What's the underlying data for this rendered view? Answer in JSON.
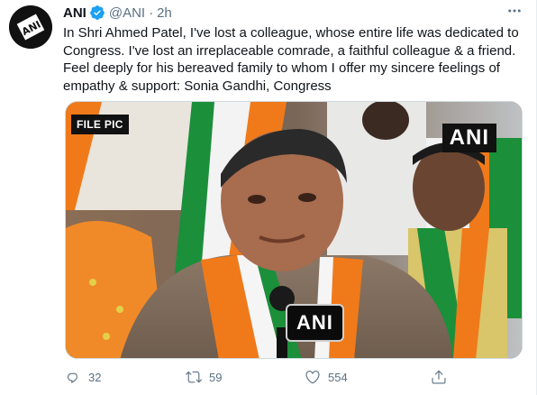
{
  "tweet": {
    "author_name": "ANI",
    "handle": "@ANI",
    "separator": "·",
    "time": "2h",
    "text": "In Shri Ahmed Patel, I've lost a colleague, whose entire life was dedicated to Congress. I've lost an irreplaceable comrade, a faithful colleague & a friend. Feel deeply for his bereaved family to whom I offer my sincere feelings of empathy & support: Sonia Gandhi, Congress",
    "verified": true,
    "accent_color": "#1da1f2"
  },
  "media": {
    "file_pic_label": "FILE PIC",
    "watermark": "ANI",
    "mic_label": "ANI"
  },
  "actions": {
    "reply_count": "32",
    "retweet_count": "59",
    "like_count": "554",
    "icons": [
      "reply-icon",
      "retweet-icon",
      "like-icon",
      "share-icon"
    ]
  },
  "avatar_logo_text": "ANI"
}
